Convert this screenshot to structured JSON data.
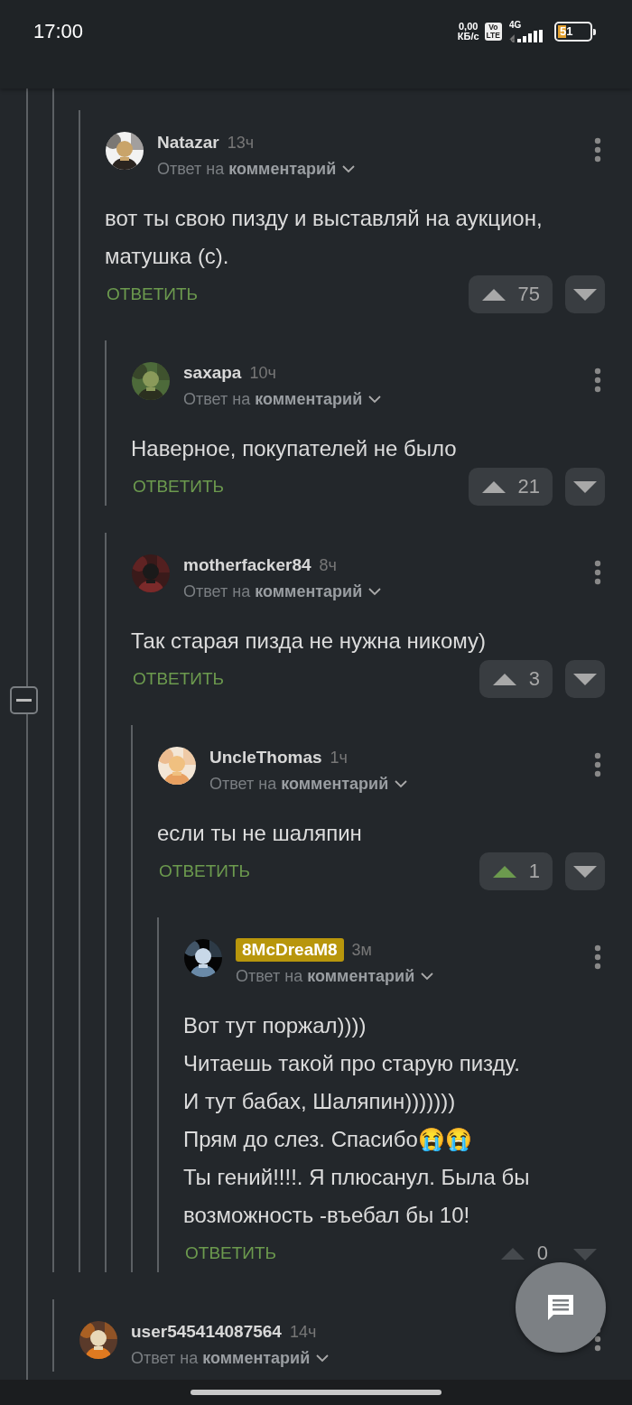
{
  "status_bar": {
    "time": "17:00",
    "speed": "0,00",
    "speed_unit": "КБ/с",
    "volte": [
      "Vo",
      "LTE"
    ],
    "network": "4G",
    "battery": "51"
  },
  "comments": [
    {
      "children": [
        {
          "author": "Natazar",
          "time": "13ч",
          "highlighted": false,
          "avatar": {
            "kind": "picture"
          },
          "reply_prefix": "Ответ на",
          "reply_target": "комментарий",
          "body": "вот ты свою пизду и выставляй на аукцион, матушка (с).",
          "reply_label": "ОТВЕТИТЬ",
          "votes": "75",
          "upvoted": false,
          "vote_disabled": false,
          "children": [
            {
              "author": "saxapa",
              "time": "10ч",
              "highlighted": false,
              "avatar": {
                "kind": "picture"
              },
              "reply_prefix": "Ответ на",
              "reply_target": "комментарий",
              "body": "Наверное, покупателей не было",
              "reply_label": "ОТВЕТИТЬ",
              "votes": "21",
              "upvoted": false,
              "vote_disabled": false
            },
            {
              "author": "motherfacker84",
              "time": "8ч",
              "highlighted": false,
              "avatar": {
                "kind": "picture"
              },
              "reply_prefix": "Ответ на",
              "reply_target": "комментарий",
              "body": "Так старая пизда не нужна никому)",
              "reply_label": "ОТВЕТИТЬ",
              "votes": "3",
              "upvoted": false,
              "vote_disabled": false,
              "children": [
                {
                  "author": "UncleThomas",
                  "time": "1ч",
                  "highlighted": false,
                  "avatar": {
                    "kind": "picture"
                  },
                  "reply_prefix": "Ответ на",
                  "reply_target": "комментарий",
                  "body": "если ты не шаляпин",
                  "reply_label": "ОТВЕТИТЬ",
                  "votes": "1",
                  "upvoted": true,
                  "vote_disabled": false,
                  "children": [
                    {
                      "author": "8McDreaM8",
                      "time": "3м",
                      "highlighted": true,
                      "avatar": {
                        "kind": "picture"
                      },
                      "reply_prefix": "Ответ на",
                      "reply_target": "комментарий",
                      "body": "Вот тут поржал))))\nЧитаешь такой про старую пизду.\nИ тут бабах, Шаляпин)))))))\nПрям до слез. Спасибо😭😭\nТы гений!!!!. Я плюсанул. Была бы возможность -въебал бы 10!",
                      "reply_label": "ОТВЕТИТЬ",
                      "votes": "0",
                      "upvoted": false,
                      "vote_disabled": true
                    }
                  ]
                }
              ]
            }
          ]
        }
      ]
    },
    {
      "author": "user545414087564",
      "time": "14ч",
      "highlighted": false,
      "avatar": {
        "kind": "picture"
      },
      "reply_prefix": "Ответ на",
      "reply_target": "комментарий"
    }
  ]
}
